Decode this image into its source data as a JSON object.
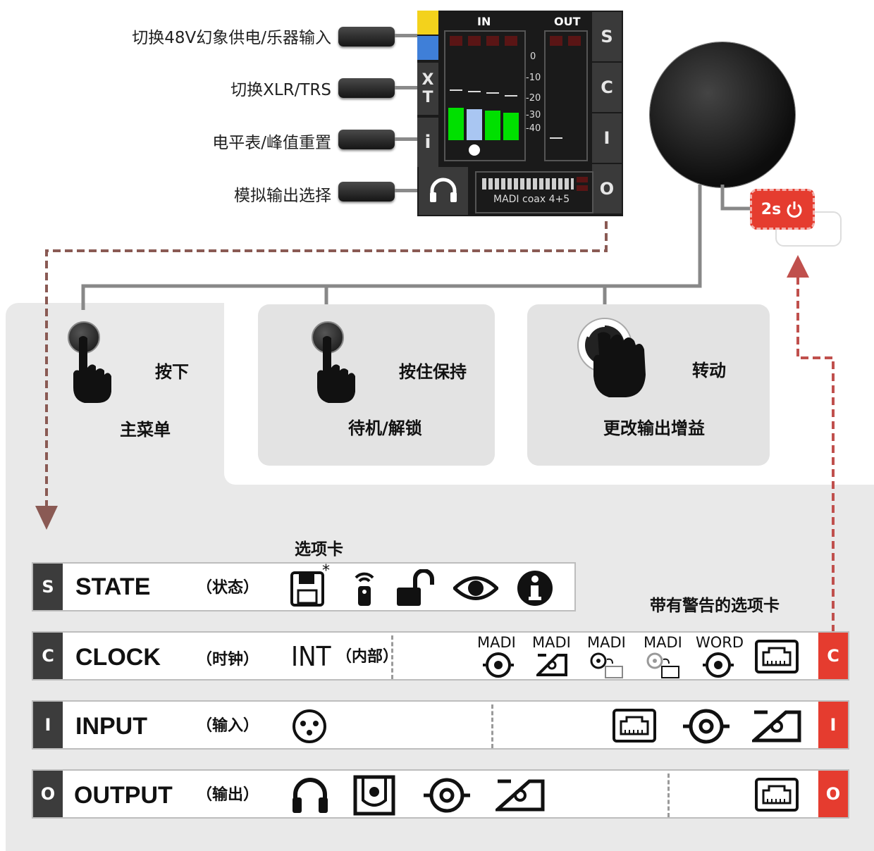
{
  "side_labels": {
    "phantom": "切换48V幻象供电/乐器输入",
    "xlr_trs": "切换XLR/TRS",
    "meter": "电平表/峰值重置",
    "analog_out": "模拟输出选择"
  },
  "device": {
    "in_label": "IN",
    "out_label": "OUT",
    "scale": [
      "0",
      "-10",
      "-20",
      "-30",
      "-40"
    ],
    "xt_x": "X",
    "xt_t": "T",
    "info": "i",
    "source_text": "MADI coax 4+5",
    "keys": [
      "S",
      "C",
      "I",
      "O"
    ],
    "power_badge": "2s"
  },
  "actions": {
    "press_verb": "按下",
    "press_result": "主菜单",
    "hold_verb": "按住保持",
    "hold_result": "待机/解锁",
    "turn_verb": "转动",
    "turn_result": "更改输出增益"
  },
  "tabs_title": "选项卡",
  "warn_title": "带有警告的选项卡",
  "rows": {
    "state": {
      "key": "S",
      "name": "STATE",
      "cn": "（状态）",
      "asterisk": "*"
    },
    "clock": {
      "key": "C",
      "name": "CLOCK",
      "cn": "（时钟）",
      "int": "INT",
      "int_cn": "（内部）",
      "sources": [
        "MADI",
        "MADI",
        "MADI",
        "MADI",
        "WORD"
      ],
      "warn": "C"
    },
    "input": {
      "key": "I",
      "name": "INPUT",
      "cn": "（输入）",
      "warn": "I"
    },
    "output": {
      "key": "O",
      "name": "OUTPUT",
      "cn": "（输出）",
      "warn": "O"
    }
  },
  "colors": {
    "meter_green": "#00e000",
    "meter_blue": "#a9c6f2",
    "warning_red": "#e53c2f",
    "dashed_brown": "#8a5a54",
    "dashed_red": "#c0504d",
    "phantom_yellow": "#f3d21c",
    "inst_blue": "#3f7fd8"
  }
}
